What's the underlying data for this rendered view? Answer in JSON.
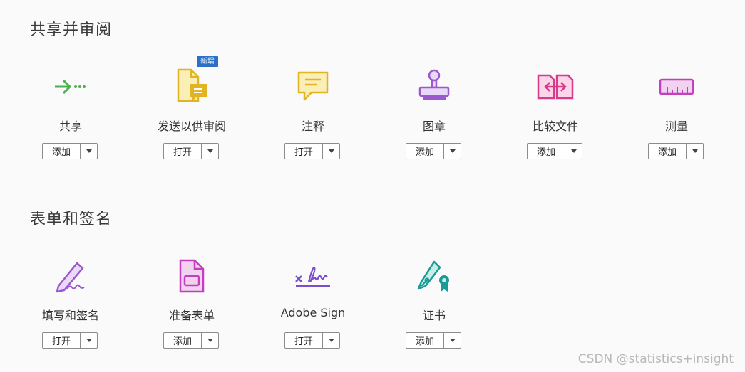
{
  "sections": {
    "share_review": {
      "title": "共享并审阅",
      "new_badge": "新增",
      "tools": [
        {
          "label": "共享",
          "button": "添加",
          "icon": "share-arrow-icon"
        },
        {
          "label": "发送以供审阅",
          "button": "打开",
          "icon": "send-for-review-icon"
        },
        {
          "label": "注释",
          "button": "打开",
          "icon": "comment-icon"
        },
        {
          "label": "图章",
          "button": "添加",
          "icon": "stamp-icon"
        },
        {
          "label": "比较文件",
          "button": "添加",
          "icon": "compare-files-icon"
        },
        {
          "label": "测量",
          "button": "添加",
          "icon": "ruler-icon"
        }
      ]
    },
    "forms_signatures": {
      "title": "表单和签名",
      "tools": [
        {
          "label": "填写和签名",
          "button": "打开",
          "icon": "fill-sign-pen-icon"
        },
        {
          "label": "准备表单",
          "button": "添加",
          "icon": "prepare-form-icon"
        },
        {
          "label": "Adobe Sign",
          "button": "打开",
          "icon": "adobe-sign-icon"
        },
        {
          "label": "证书",
          "button": "添加",
          "icon": "certificate-icon"
        }
      ]
    }
  },
  "colors": {
    "share": "#4caf50",
    "send": "#e0b422",
    "comment": "#e0b422",
    "stamp": "#9b59d0",
    "compare": "#d83a8c",
    "measure": "#c33fbf",
    "fill_sign": "#9b59d0",
    "prepare_form": "#c33fbf",
    "adobe_sign": "#7b4fc9",
    "certificate": "#1a9a94",
    "badge": "#2d6fc4"
  },
  "watermark": "CSDN @statistics+insight"
}
